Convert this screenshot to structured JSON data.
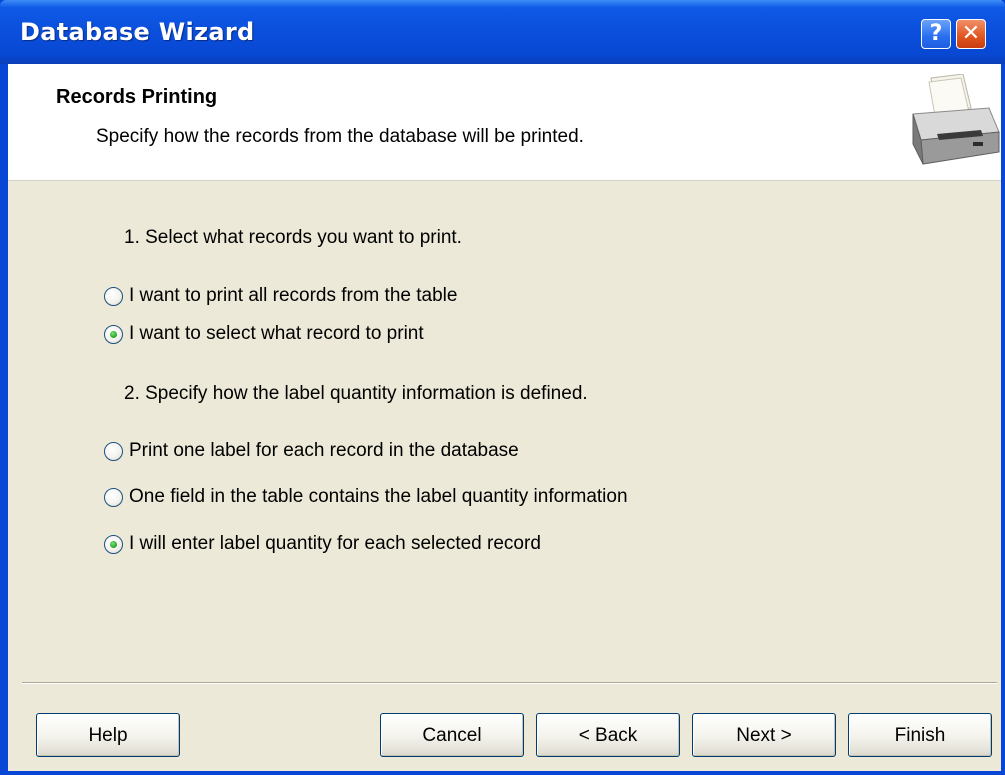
{
  "window": {
    "title": "Database Wizard",
    "help_glyph": "?",
    "close_glyph": "✕"
  },
  "header": {
    "title": "Records Printing",
    "subtitle": "Specify how the records from the database will be printed.",
    "icon": "printer-icon"
  },
  "section1": {
    "label": "1. Select what records you want to print.",
    "options": [
      {
        "label": "I want to print all records from the table",
        "checked": false
      },
      {
        "label": "I want to select what record to print",
        "checked": true
      }
    ]
  },
  "section2": {
    "label": "2. Specify how the label quantity information is defined.",
    "options": [
      {
        "label": "Print one label for each record in the database",
        "checked": false
      },
      {
        "label": "One field in the table contains the label quantity information",
        "checked": false
      },
      {
        "label": "I will enter label quantity for each selected record",
        "checked": true
      }
    ]
  },
  "buttons": {
    "help": "Help",
    "cancel": "Cancel",
    "back": "< Back",
    "next": "Next >",
    "finish": "Finish"
  },
  "colors": {
    "titlebar": "#0a4fdc",
    "dialog_bg": "#ece9d8",
    "radio_checked": "#21a121"
  }
}
